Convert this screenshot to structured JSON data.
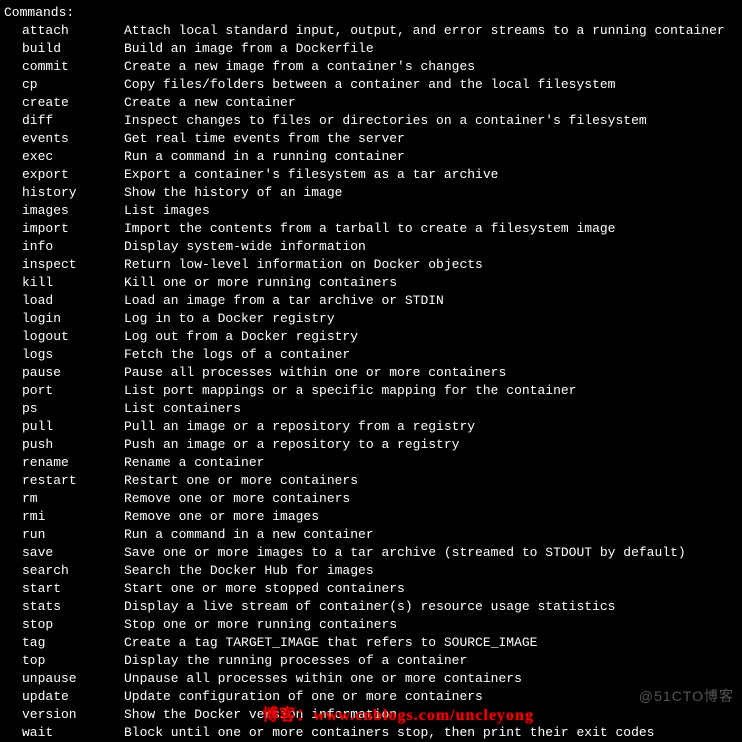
{
  "header": "Commands:",
  "commands": [
    {
      "name": "attach",
      "desc": "Attach local standard input, output, and error streams to a running container"
    },
    {
      "name": "build",
      "desc": "Build an image from a Dockerfile"
    },
    {
      "name": "commit",
      "desc": "Create a new image from a container's changes"
    },
    {
      "name": "cp",
      "desc": "Copy files/folders between a container and the local filesystem"
    },
    {
      "name": "create",
      "desc": "Create a new container"
    },
    {
      "name": "diff",
      "desc": "Inspect changes to files or directories on a container's filesystem"
    },
    {
      "name": "events",
      "desc": "Get real time events from the server"
    },
    {
      "name": "exec",
      "desc": "Run a command in a running container"
    },
    {
      "name": "export",
      "desc": "Export a container's filesystem as a tar archive"
    },
    {
      "name": "history",
      "desc": "Show the history of an image"
    },
    {
      "name": "images",
      "desc": "List images"
    },
    {
      "name": "import",
      "desc": "Import the contents from a tarball to create a filesystem image"
    },
    {
      "name": "info",
      "desc": "Display system-wide information"
    },
    {
      "name": "inspect",
      "desc": "Return low-level information on Docker objects"
    },
    {
      "name": "kill",
      "desc": "Kill one or more running containers"
    },
    {
      "name": "load",
      "desc": "Load an image from a tar archive or STDIN"
    },
    {
      "name": "login",
      "desc": "Log in to a Docker registry"
    },
    {
      "name": "logout",
      "desc": "Log out from a Docker registry"
    },
    {
      "name": "logs",
      "desc": "Fetch the logs of a container"
    },
    {
      "name": "pause",
      "desc": "Pause all processes within one or more containers"
    },
    {
      "name": "port",
      "desc": "List port mappings or a specific mapping for the container"
    },
    {
      "name": "ps",
      "desc": "List containers"
    },
    {
      "name": "pull",
      "desc": "Pull an image or a repository from a registry"
    },
    {
      "name": "push",
      "desc": "Push an image or a repository to a registry"
    },
    {
      "name": "rename",
      "desc": "Rename a container"
    },
    {
      "name": "restart",
      "desc": "Restart one or more containers"
    },
    {
      "name": "rm",
      "desc": "Remove one or more containers"
    },
    {
      "name": "rmi",
      "desc": "Remove one or more images"
    },
    {
      "name": "run",
      "desc": "Run a command in a new container"
    },
    {
      "name": "save",
      "desc": "Save one or more images to a tar archive (streamed to STDOUT by default)"
    },
    {
      "name": "search",
      "desc": "Search the Docker Hub for images"
    },
    {
      "name": "start",
      "desc": "Start one or more stopped containers"
    },
    {
      "name": "stats",
      "desc": "Display a live stream of container(s) resource usage statistics"
    },
    {
      "name": "stop",
      "desc": "Stop one or more running containers"
    },
    {
      "name": "tag",
      "desc": "Create a tag TARGET_IMAGE that refers to SOURCE_IMAGE"
    },
    {
      "name": "top",
      "desc": "Display the running processes of a container"
    },
    {
      "name": "unpause",
      "desc": "Unpause all processes within one or more containers"
    },
    {
      "name": "update",
      "desc": "Update configuration of one or more containers"
    },
    {
      "name": "version",
      "desc": "Show the Docker version information"
    },
    {
      "name": "wait",
      "desc": "Block until one or more containers stop, then print their exit codes"
    }
  ],
  "watermark_right": "@51CTO博客",
  "watermark_bottom_label": "博客：",
  "watermark_bottom_url": "www.cnblogs.com/uncleyong"
}
